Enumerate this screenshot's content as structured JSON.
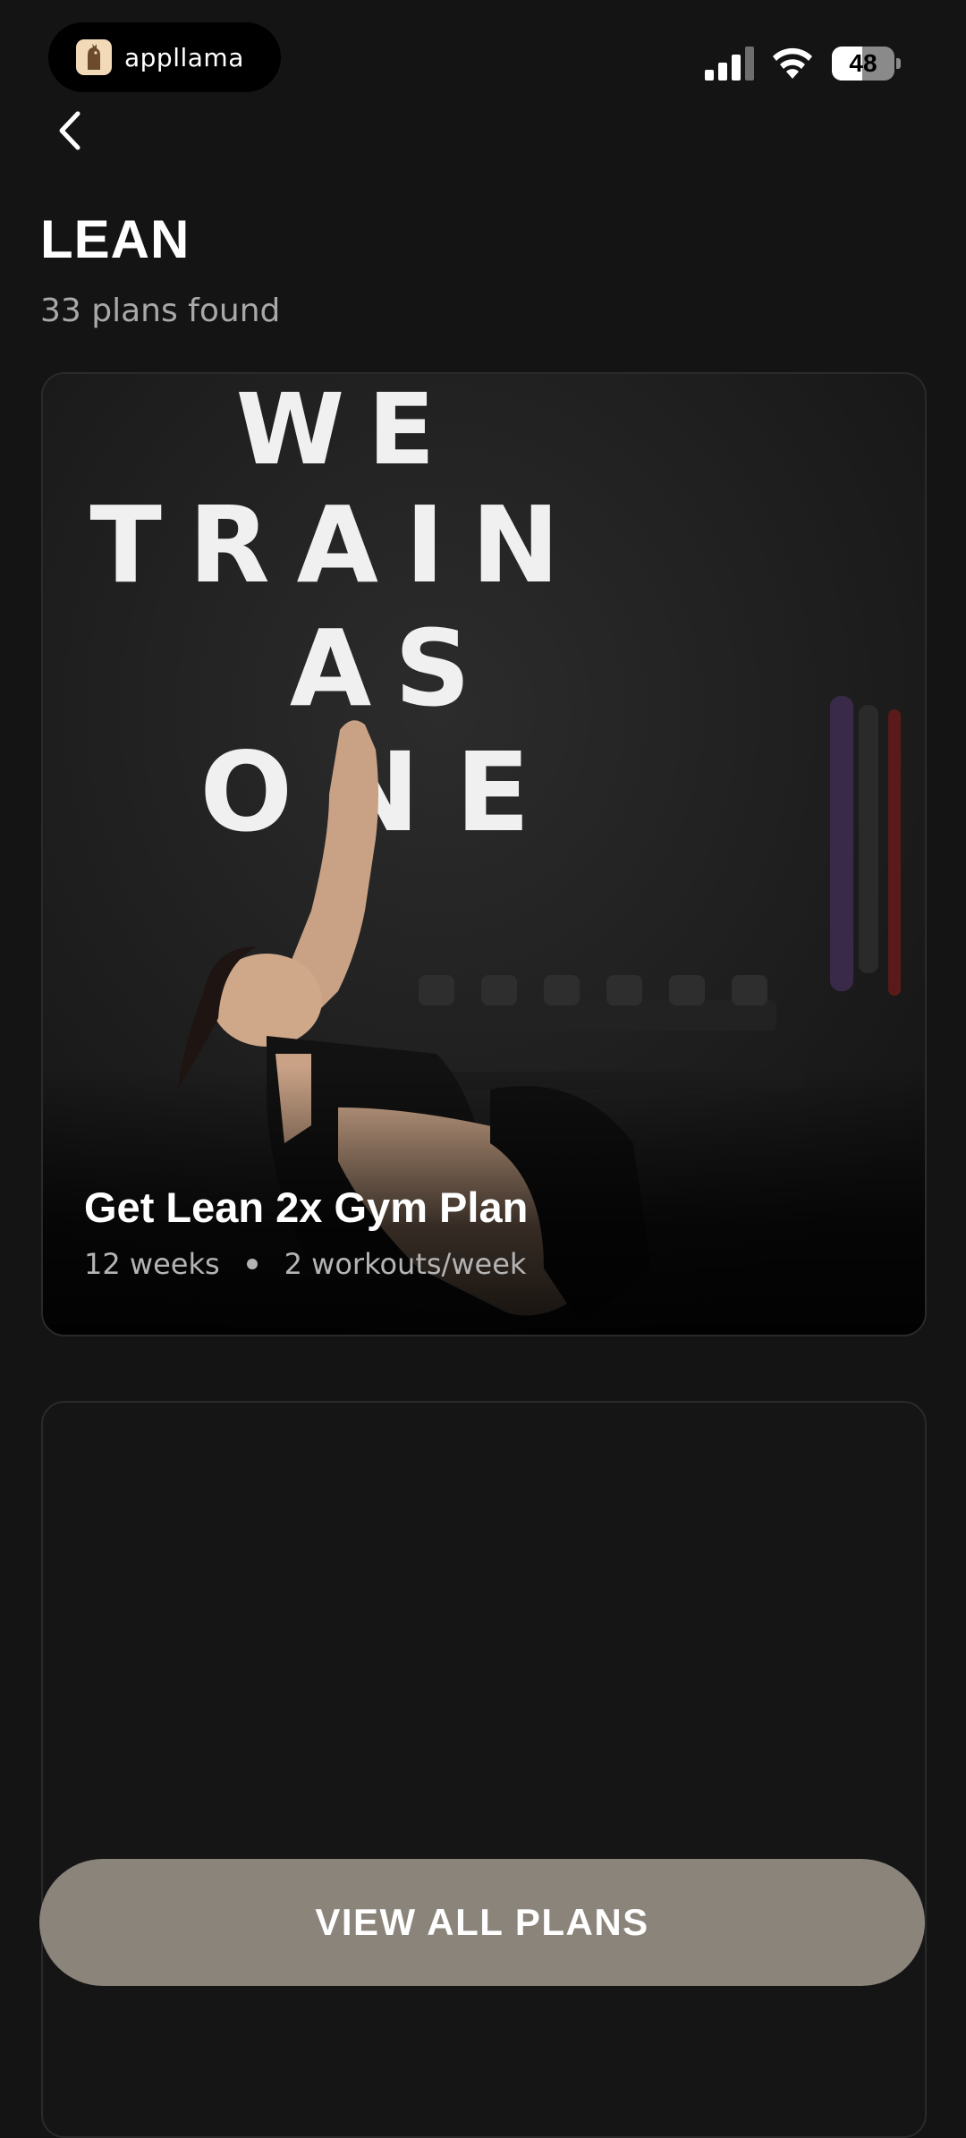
{
  "status_bar": {
    "app_name": "appllama",
    "battery_level": "48",
    "battery_fraction": 0.48,
    "signal_icon": "cellular-signal-icon",
    "wifi_icon": "wifi-icon"
  },
  "header": {
    "back_icon": "chevron-left-icon",
    "title": "LEAN",
    "results_count": "33 plans found"
  },
  "photo_sign": [
    "WE",
    "TRAIN",
    "AS",
    "ONE"
  ],
  "plans": [
    {
      "title": "Get Lean 2x Gym Plan",
      "duration": "12 weeks",
      "frequency": "2 workouts/week"
    }
  ],
  "cta": {
    "label": "VIEW ALL PLANS"
  },
  "colors": {
    "background": "#141414",
    "cta": "#8b847a",
    "muted_text": "#a9a9a9"
  }
}
